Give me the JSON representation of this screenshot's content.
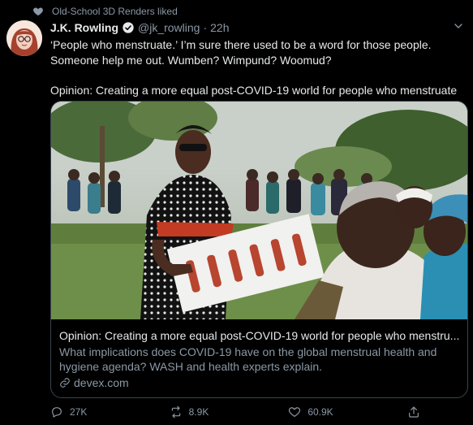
{
  "social_context": {
    "text": "Old-School 3D Renders liked"
  },
  "tweet": {
    "author_name": "J.K. Rowling",
    "handle": "@jk_rowling",
    "dot": "·",
    "time": "22h",
    "text": "‘People who menstruate.’ I’m sure there used to be a word for those people. Someone help me out. Wumben? Wimpund? Woomud?\n\nOpinion: Creating a more equal post-COVID-19 world for people who menstruate"
  },
  "card": {
    "title": "Opinion: Creating a more equal post-COVID-19 world for people who menstru...",
    "description": "What implications does COVID-19 have on the global menstrual health and hygiene agenda? WASH and health experts explain.",
    "domain": "devex.com"
  },
  "actions": {
    "reply_count": "27K",
    "retweet_count": "8.9K",
    "like_count": "60.9K"
  }
}
